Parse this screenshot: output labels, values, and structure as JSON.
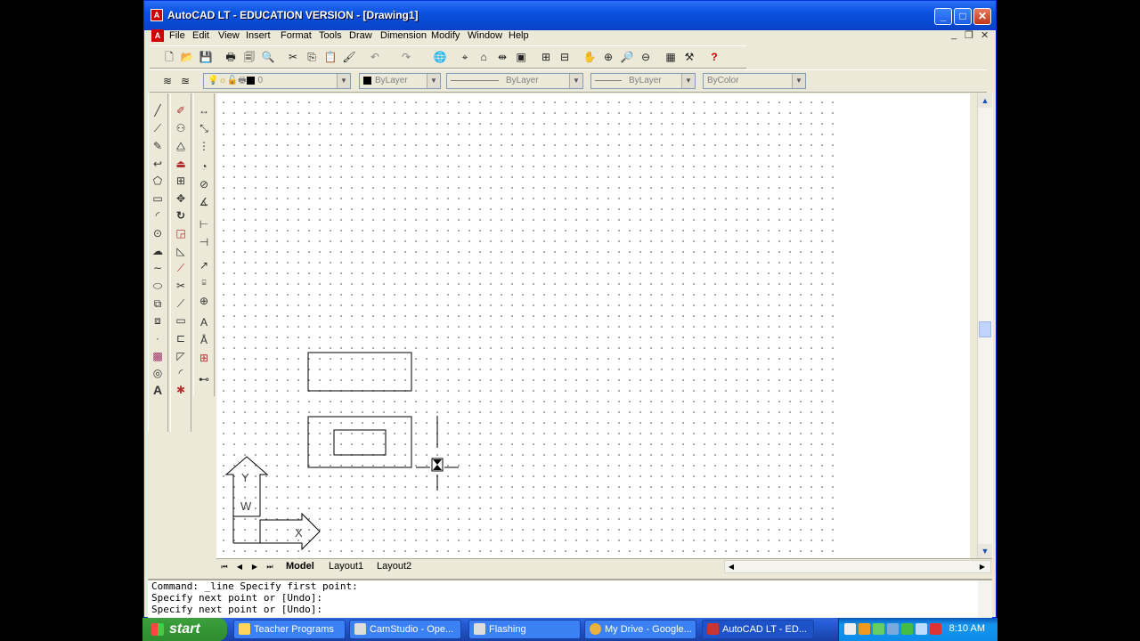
{
  "window": {
    "title": "AutoCAD LT - EDUCATION VERSION - [Drawing1]",
    "app_icon": "autocad-logo",
    "controls": {
      "minimize": "_",
      "maximize": "□",
      "close": "✕"
    }
  },
  "menubar": {
    "items": [
      "File",
      "Edit",
      "View",
      "Insert",
      "Format",
      "Tools",
      "Draw",
      "Dimension",
      "Modify",
      "Window",
      "Help"
    ],
    "mdi_controls": {
      "minimize": "_",
      "restore": "❐",
      "close": "✕"
    }
  },
  "properties_bar": {
    "layer": "0",
    "color": "ByLayer",
    "linetype": "ByLayer",
    "lineweight": "ByLayer",
    "plotstyle": "ByColor"
  },
  "canvas": {
    "ucs_labels": {
      "y": "Y",
      "w": "W",
      "x": "X"
    }
  },
  "tabs": {
    "items": [
      "Model",
      "Layout1",
      "Layout2"
    ],
    "active": "Model"
  },
  "command_line": {
    "lines": [
      "Command: _line Specify first point:",
      "Specify next point or [Undo]:",
      "Specify next point or [Undo]:"
    ]
  },
  "taskbar": {
    "start_label": "start",
    "tasks": [
      {
        "label": "Teacher Programs",
        "active": false
      },
      {
        "label": "CamStudio - Ope...",
        "active": false
      },
      {
        "label": "Flashing",
        "active": false
      },
      {
        "label": "My Drive - Google...",
        "active": false
      },
      {
        "label": "AutoCAD LT - ED...",
        "active": true
      }
    ],
    "clock": "8:10 AM"
  }
}
